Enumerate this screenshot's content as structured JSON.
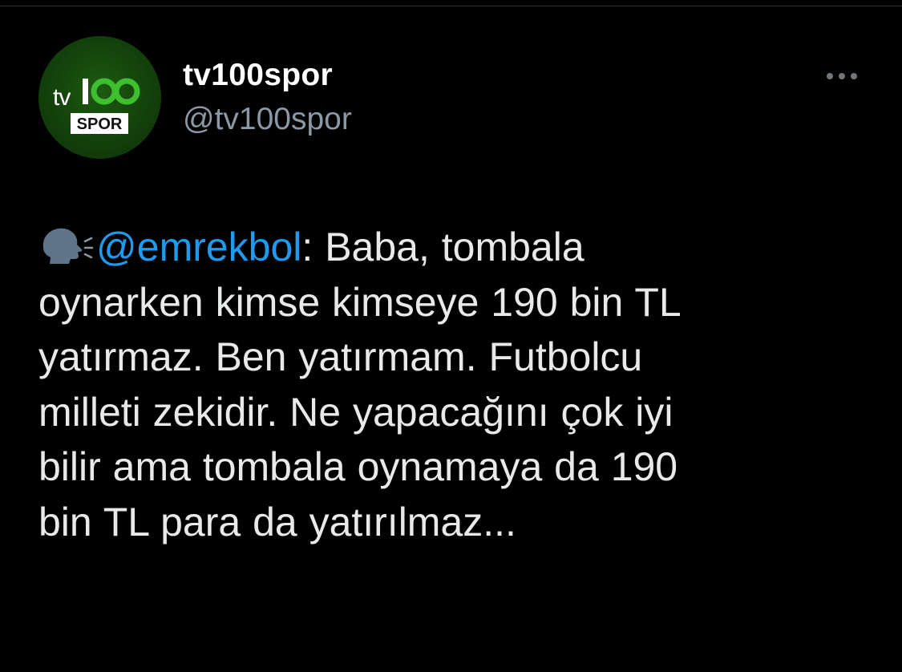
{
  "tweet": {
    "avatar_logo": {
      "brand": "tv100",
      "sub": "SPOR"
    },
    "author": {
      "display_name": "tv100spor",
      "handle": "@tv100spor"
    },
    "more_icon": "more-horizontal-icon",
    "emoji": "speaking-head-icon",
    "mention": "@emrekbol",
    "text_lines": [
      ": Baba, tombala",
      "oynarken kimse kimseye 190 bin TL",
      "yatırmaz. Ben yatırmam. Futbolcu",
      "milleti zekidir. Ne yapacağını çok iyi",
      "bilir ama tombala oynamaya da 190",
      "bin TL para da yatırılmaz..."
    ]
  },
  "colors": {
    "background": "#000000",
    "text": "#e7e9ea",
    "secondary_text": "#8b98a5",
    "link": "#1d9bf0",
    "avatar_green": "#123f0a",
    "logo_green": "#3fbf2f"
  }
}
